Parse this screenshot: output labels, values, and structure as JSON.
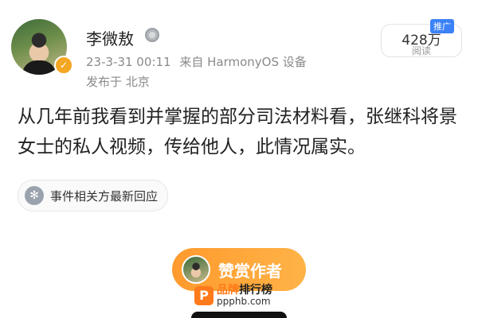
{
  "author": {
    "name": "李微敖",
    "verified_icon": "check-badge-icon",
    "medal_icon": "medal-icon"
  },
  "meta": {
    "timestamp": "23-3-31 00:11",
    "source": "来自 HarmonyOS 设备",
    "location": "发布于 北京"
  },
  "stats": {
    "reads_count": "428万",
    "reads_label": "阅读",
    "promo_tag": "推广"
  },
  "post": {
    "text": "从几年前我看到并掌握的部分司法材料看，张继科将景女士的私人视频，传给他人，此情况属实。"
  },
  "topic": {
    "icon": "topic-icon",
    "label": "事件相关方最新回应"
  },
  "reward": {
    "label": "赞赏作者"
  },
  "watermark": {
    "brand_part1": "品牌",
    "brand_part2": "排行榜",
    "url": "ppphb.com"
  },
  "colors": {
    "accent_orange": "#ff9a2e",
    "badge_blue": "#3b82f6",
    "verify_gold": "#f5a623"
  }
}
